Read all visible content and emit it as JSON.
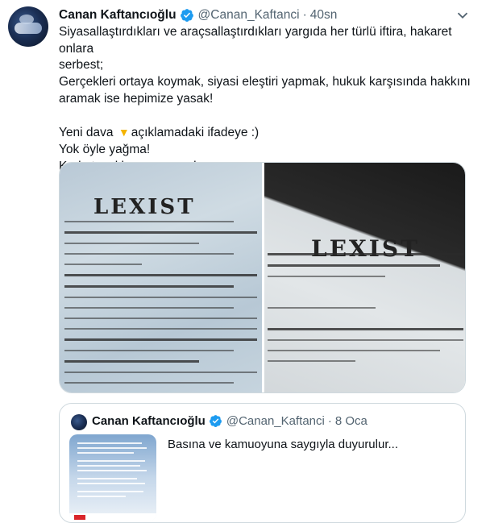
{
  "tweet": {
    "author_name": "Canan Kaftancıoğlu",
    "handle": "@Canan_Kaftanci",
    "separator": "·",
    "time": "40sn",
    "lines": [
      "Siyasallaştırdıkları ve araçsallaştırdıkları yargıda her türlü iftira, hakaret onlara",
      "serbest;",
      "Gerçekleri ortaya koymak, siyasi eleştiri yapmak, hukuk karşısında hakkını",
      "aramak ise hepimize yasak!",
      "",
      "Yeni dava",
      "açıklamadaki ifadeye :)",
      "Yok öyle yağma!",
      "Korkutacaklarını sanıyorlar"
    ]
  },
  "media": {
    "left_watermark": "LEXIST",
    "right_watermark": "LEXIST"
  },
  "quoted_tweet": {
    "author_name": "Canan Kaftancıoğlu",
    "handle": "@Canan_Kaftanci",
    "separator": "·",
    "time": "8 Oca",
    "text": "Basına ve kamuoyuna saygıyla duyurulur..."
  },
  "colors": {
    "verified": "#1d9bf0",
    "secondary_text": "#536471",
    "border": "#cfd9de"
  },
  "icons": [
    "verified-badge-icon",
    "more-options-chevron-icon",
    "pointing-down-emoji-icon"
  ]
}
